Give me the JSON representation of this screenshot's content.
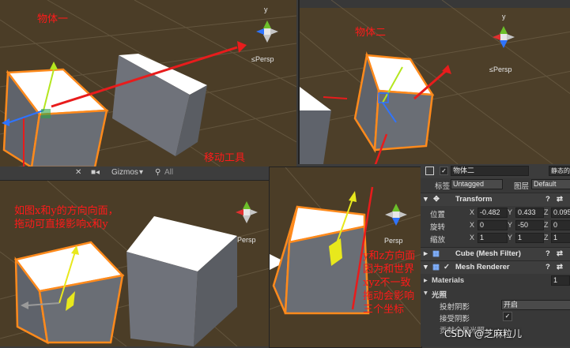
{
  "scene_top_left": {
    "annotation": "物体一",
    "persp": "≤Persp",
    "gizmo_axis": "y"
  },
  "scene_top_right": {
    "annotation": "物体二",
    "persp": "≤Persp",
    "gizmo_axis": "y"
  },
  "move_tool_label": "移动工具",
  "toolbar": {
    "tools": "✕",
    "camera": "■◂",
    "gizmos": "Gizmos",
    "dropdown": "▾",
    "search_placeholder": "All"
  },
  "scene_bottom_left": {
    "annotation_lines": [
      "如图x和y的方向向面，",
      "拖动可直接影响x和y"
    ],
    "persp": "Persp"
  },
  "scene_bottom_right": {
    "annotation_lines": [
      "y和z方向面",
      "因为和世界",
      "xyz不一致",
      "拖动会影响",
      "三个坐标"
    ],
    "persp": "Persp"
  },
  "inspector": {
    "object_name": "物体二",
    "static_label": "静态的",
    "tag_label": "标签",
    "tag_value": "Untagged",
    "layer_label": "图层",
    "layer_value": "Default",
    "transform": {
      "title": "Transform",
      "position_label": "位置",
      "rotation_label": "旋转",
      "scale_label": "缩放",
      "position": {
        "x": "-0.482",
        "y": "0.433",
        "z": "0.095"
      },
      "rotation": {
        "x": "0",
        "y": "-50",
        "z": "0"
      },
      "scale": {
        "x": "1",
        "y": "1",
        "z": "1"
      }
    },
    "mesh_filter_title": "Cube (Mesh Filter)",
    "mesh_renderer_title": "Mesh Renderer",
    "materials_label": "Materials",
    "materials_count": "1",
    "lighting_label": "光照",
    "cast_shadows_label": "投射阴影",
    "cast_shadows_value": "开启",
    "receive_shadows_label": "接受阴影",
    "contribute_gi_label": "贡献全局光照"
  },
  "watermark": "CSDN @芝麻粒儿",
  "colors": {
    "annotation": "#ff1a1a",
    "outline": "#ff8a1c",
    "arrow": "#e81c1c",
    "y_axis": "#b4e61e",
    "x_axis": "#e23030",
    "z_axis": "#2f74ff"
  }
}
